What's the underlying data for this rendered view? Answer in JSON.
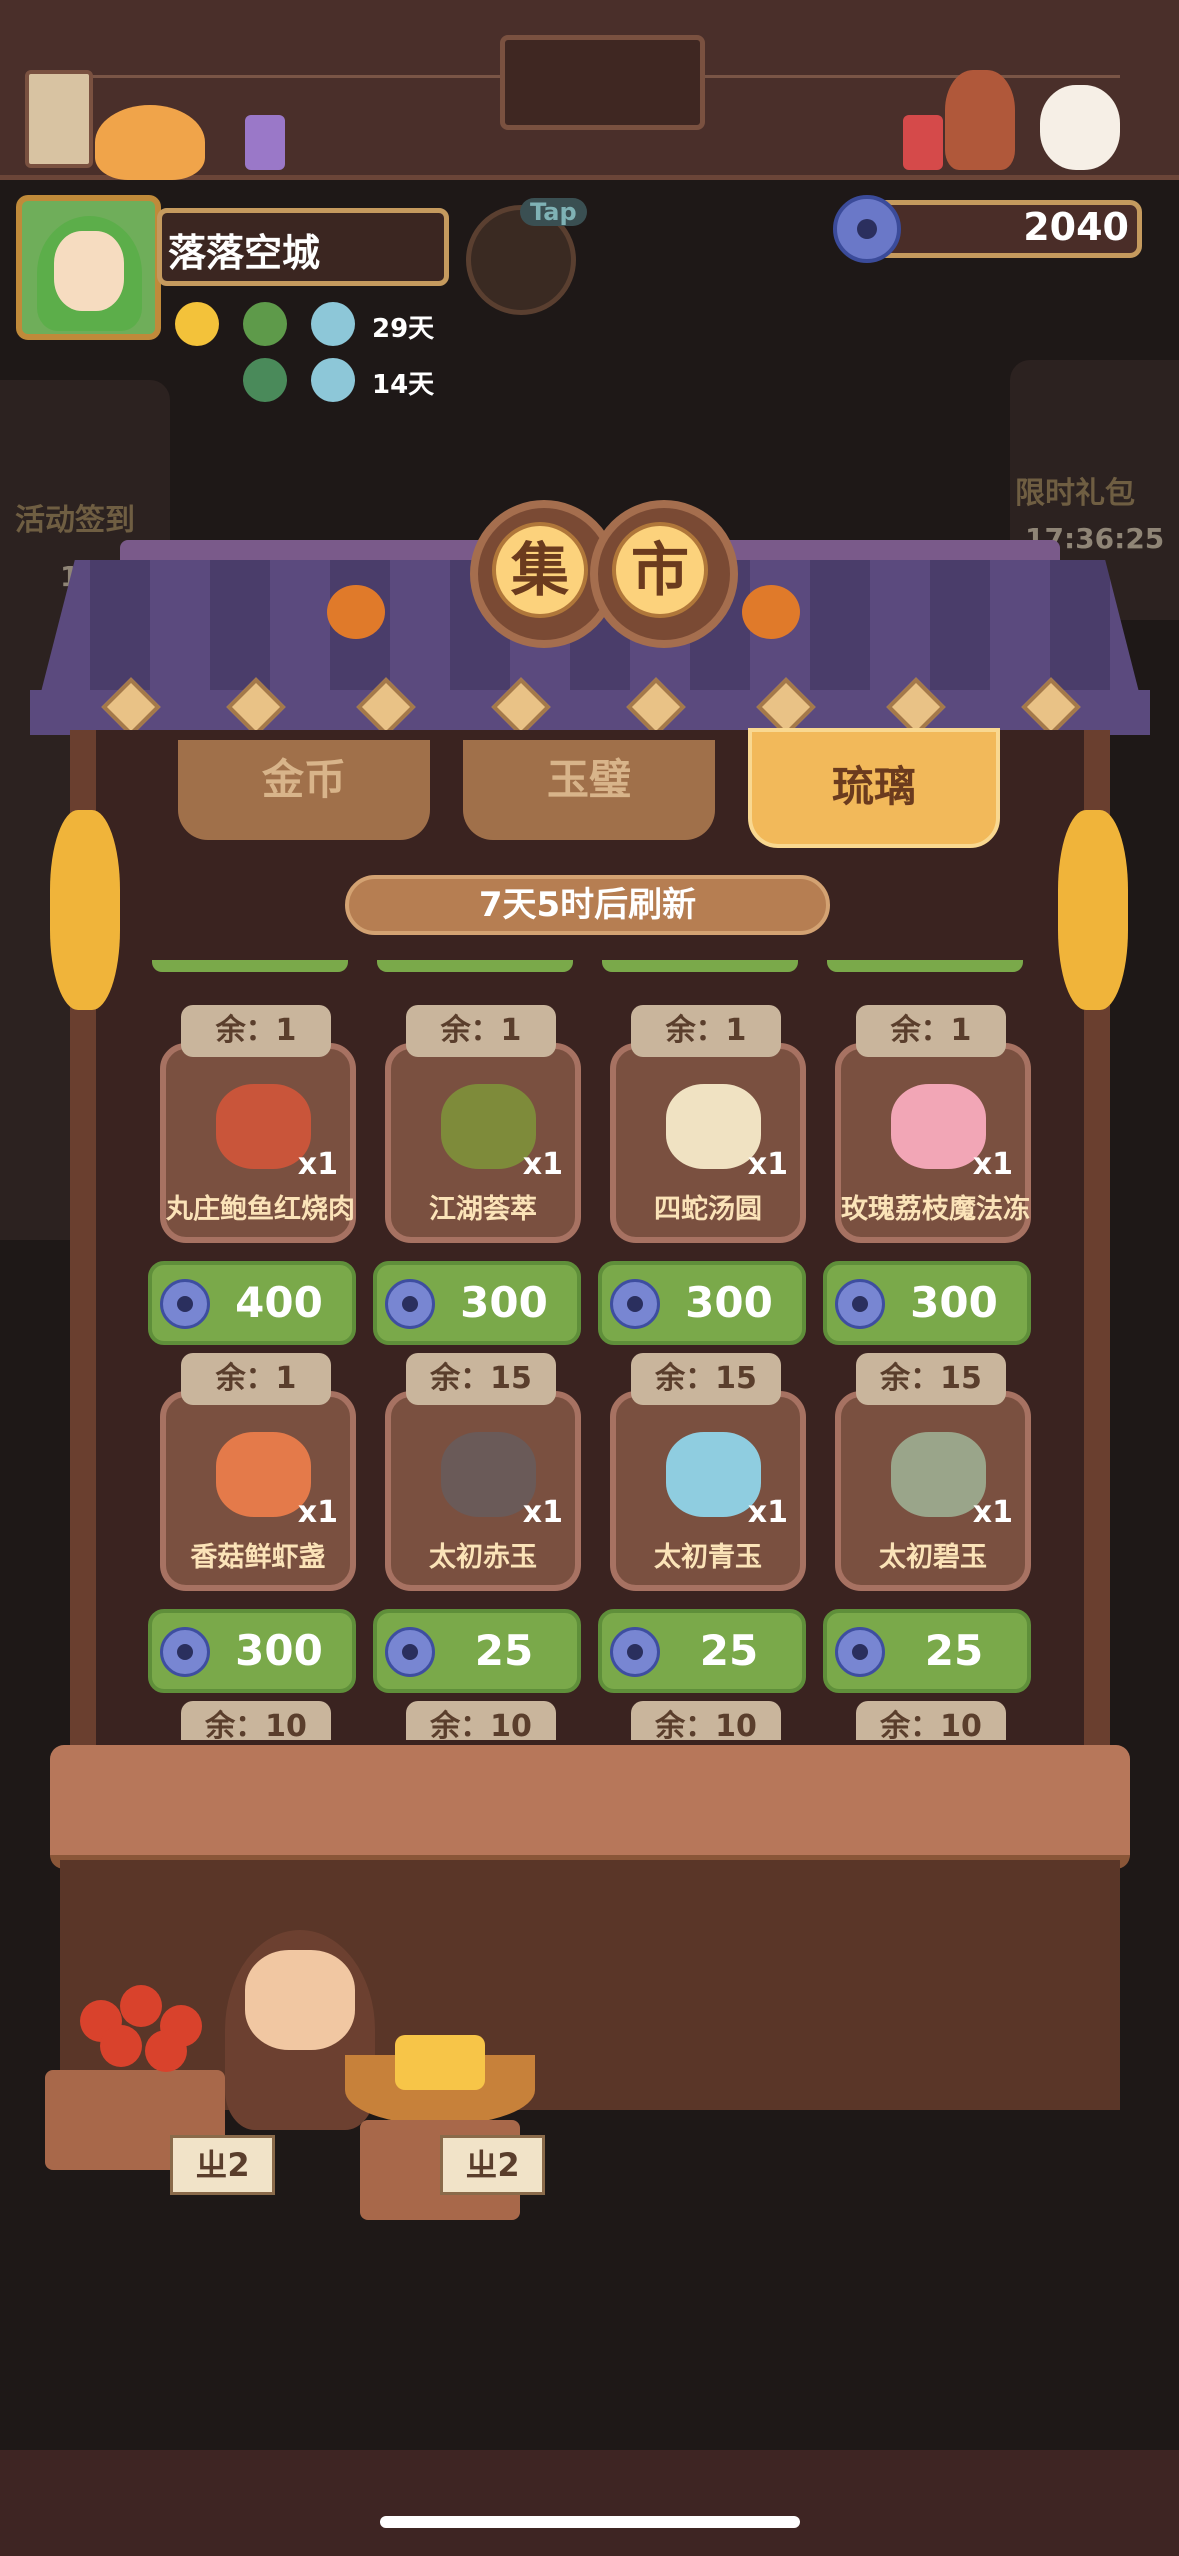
{
  "profile": {
    "name": "落落空城",
    "badge_row1_days": "29天",
    "badge_row2_days": "14天"
  },
  "currency": {
    "value": "2040",
    "icon": "glaze-coin-icon"
  },
  "background": {
    "left_event_label": "活动签到",
    "left_event_days": "14天",
    "right_event_label": "限时礼包",
    "right_event_timer": "17:36:25",
    "tap_label": "Tap"
  },
  "market": {
    "sign_chars": [
      "集",
      "市"
    ],
    "tabs": [
      {
        "label": "金币",
        "active": false
      },
      {
        "label": "玉璧",
        "active": false
      },
      {
        "label": "琉璃",
        "active": true
      }
    ],
    "refresh_text": "7天5时后刷新",
    "items": [
      {
        "stock": "余：1",
        "name": "丸庄鲍鱼红烧肉",
        "qty": "x1",
        "price": "400",
        "color": "#c9553a"
      },
      {
        "stock": "余：1",
        "name": "江湖荟萃",
        "qty": "x1",
        "price": "300",
        "color": "#7e8b3a"
      },
      {
        "stock": "余：1",
        "name": "四蛇汤圆",
        "qty": "x1",
        "price": "300",
        "color": "#f0e2c2"
      },
      {
        "stock": "余：1",
        "name": "玫瑰荔枝魔法冻",
        "qty": "x1",
        "price": "300",
        "color": "#f2a6b6"
      },
      {
        "stock": "余：1",
        "name": "香菇鲜虾盏",
        "qty": "x1",
        "price": "300",
        "color": "#e47a4a"
      },
      {
        "stock": "余：15",
        "name": "太初赤玉",
        "qty": "x1",
        "price": "25",
        "color": "#6a5a58"
      },
      {
        "stock": "余：15",
        "name": "太初青玉",
        "qty": "x1",
        "price": "25",
        "color": "#8fcde0"
      },
      {
        "stock": "余：15",
        "name": "太初碧玉",
        "qty": "x1",
        "price": "25",
        "color": "#9aa58a"
      }
    ],
    "next_row_stock": [
      "余：10",
      "余：10",
      "余：10",
      "余：10"
    ]
  },
  "stall_tags": [
    "ㄓ2",
    "ㄓ2"
  ],
  "colors": {
    "tab_active": "#f2b95a",
    "price_button": "#7aa94a",
    "panel": "#3a2320"
  }
}
